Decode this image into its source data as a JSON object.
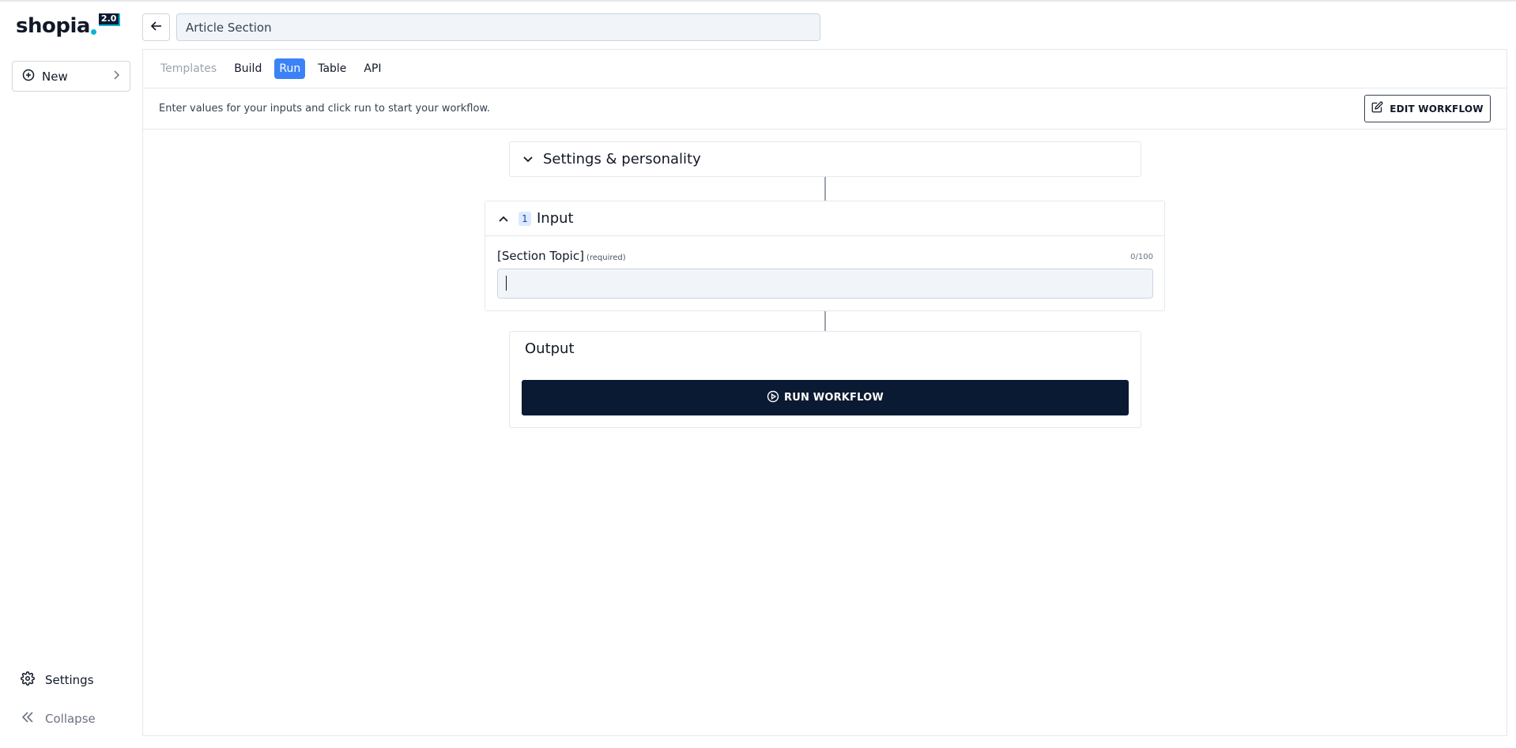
{
  "brand": {
    "name": "shopia",
    "version": "2.0"
  },
  "sidebar": {
    "new_label": "New",
    "settings_label": "Settings",
    "collapse_label": "Collapse"
  },
  "header": {
    "title_value": "Article Section"
  },
  "tabs": [
    {
      "label": "Templates",
      "state": "disabled"
    },
    {
      "label": "Build",
      "state": "normal"
    },
    {
      "label": "Run",
      "state": "active"
    },
    {
      "label": "Table",
      "state": "normal"
    },
    {
      "label": "API",
      "state": "normal"
    }
  ],
  "infobar": {
    "text": "Enter values for your inputs and click run to start your workflow.",
    "edit_label": "EDIT WORKFLOW"
  },
  "flow": {
    "settings_label": "Settings & personality",
    "input": {
      "step_number": "1",
      "title": "Input",
      "field_label": "[Section Topic]",
      "field_required": "(required)",
      "field_count": "0/100",
      "field_value": ""
    },
    "output": {
      "title": "Output",
      "run_label": "RUN WORKFLOW"
    }
  },
  "colors": {
    "accent": "#3b82f6",
    "primary_dark": "#0b1a33",
    "logo_dot": "#06b6d4"
  },
  "icons": {
    "new": "plus-circle-icon",
    "new_arrow": "chevron-right-icon",
    "back": "arrow-left-icon",
    "edit": "edit-square-icon",
    "settings_toggle": "chevron-down-icon",
    "input_toggle": "chevron-up-icon",
    "run": "play-circle-icon",
    "settings": "gear-icon",
    "collapse": "double-chevron-left-icon"
  }
}
